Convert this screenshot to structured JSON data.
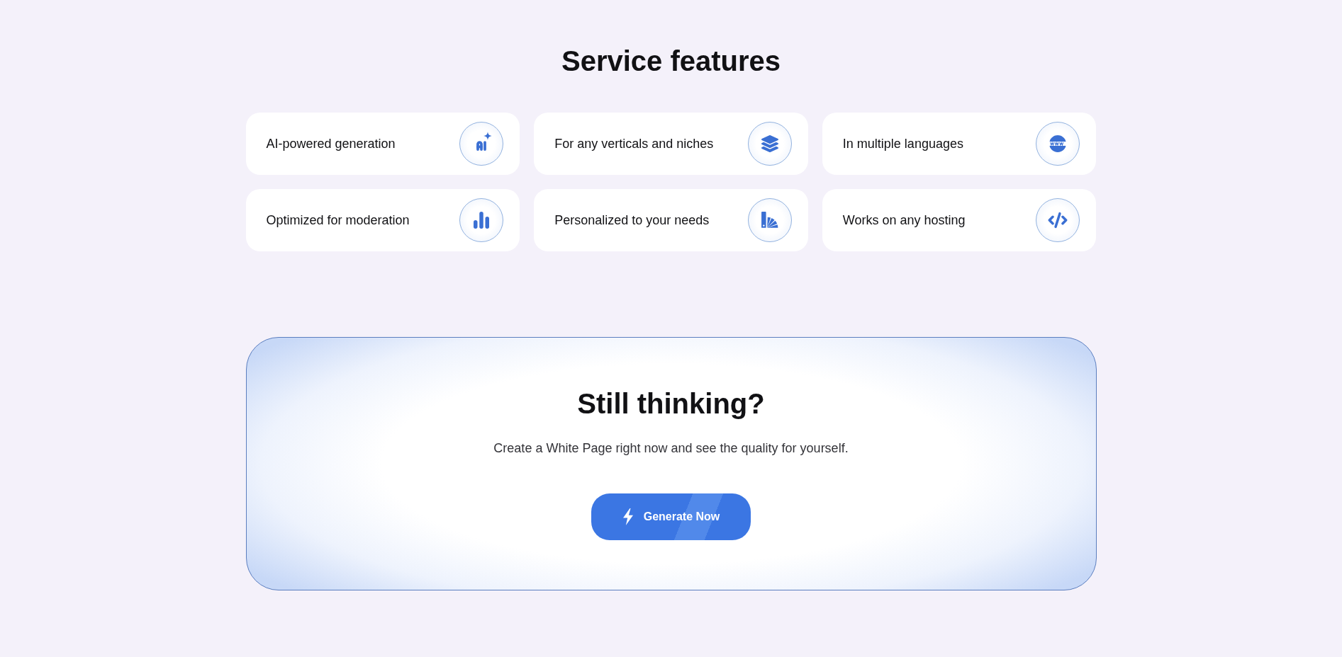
{
  "title": "Service features",
  "features": [
    {
      "label": "AI-powered generation",
      "kind": "ai"
    },
    {
      "label": "For any verticals and niches",
      "kind": "layers"
    },
    {
      "label": "In multiple languages",
      "kind": "www"
    },
    {
      "label": "Optimized for moderation",
      "kind": "chart"
    },
    {
      "label": "Personalized to your needs",
      "kind": "swatches"
    },
    {
      "label": "Works on any hosting",
      "kind": "code"
    }
  ],
  "cta": {
    "title": "Still thinking?",
    "text": "Create a White Page right now and see the quality for yourself.",
    "button": {
      "label": "Generate Now"
    }
  }
}
